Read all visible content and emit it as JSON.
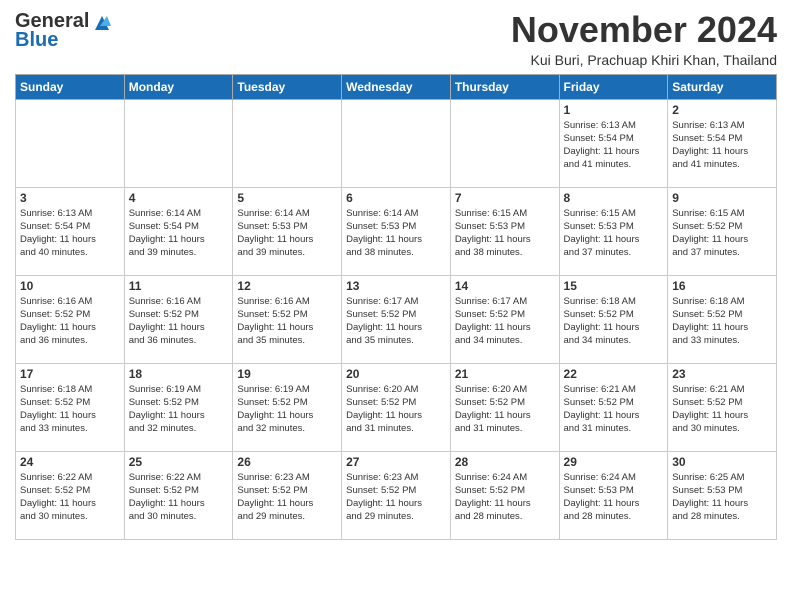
{
  "logo": {
    "general": "General",
    "blue": "Blue"
  },
  "header": {
    "month": "November 2024",
    "location": "Kui Buri, Prachuap Khiri Khan, Thailand"
  },
  "weekdays": [
    "Sunday",
    "Monday",
    "Tuesday",
    "Wednesday",
    "Thursday",
    "Friday",
    "Saturday"
  ],
  "weeks": [
    [
      {
        "day": "",
        "info": ""
      },
      {
        "day": "",
        "info": ""
      },
      {
        "day": "",
        "info": ""
      },
      {
        "day": "",
        "info": ""
      },
      {
        "day": "",
        "info": ""
      },
      {
        "day": "1",
        "info": "Sunrise: 6:13 AM\nSunset: 5:54 PM\nDaylight: 11 hours\nand 41 minutes."
      },
      {
        "day": "2",
        "info": "Sunrise: 6:13 AM\nSunset: 5:54 PM\nDaylight: 11 hours\nand 41 minutes."
      }
    ],
    [
      {
        "day": "3",
        "info": "Sunrise: 6:13 AM\nSunset: 5:54 PM\nDaylight: 11 hours\nand 40 minutes."
      },
      {
        "day": "4",
        "info": "Sunrise: 6:14 AM\nSunset: 5:54 PM\nDaylight: 11 hours\nand 39 minutes."
      },
      {
        "day": "5",
        "info": "Sunrise: 6:14 AM\nSunset: 5:53 PM\nDaylight: 11 hours\nand 39 minutes."
      },
      {
        "day": "6",
        "info": "Sunrise: 6:14 AM\nSunset: 5:53 PM\nDaylight: 11 hours\nand 38 minutes."
      },
      {
        "day": "7",
        "info": "Sunrise: 6:15 AM\nSunset: 5:53 PM\nDaylight: 11 hours\nand 38 minutes."
      },
      {
        "day": "8",
        "info": "Sunrise: 6:15 AM\nSunset: 5:53 PM\nDaylight: 11 hours\nand 37 minutes."
      },
      {
        "day": "9",
        "info": "Sunrise: 6:15 AM\nSunset: 5:52 PM\nDaylight: 11 hours\nand 37 minutes."
      }
    ],
    [
      {
        "day": "10",
        "info": "Sunrise: 6:16 AM\nSunset: 5:52 PM\nDaylight: 11 hours\nand 36 minutes."
      },
      {
        "day": "11",
        "info": "Sunrise: 6:16 AM\nSunset: 5:52 PM\nDaylight: 11 hours\nand 36 minutes."
      },
      {
        "day": "12",
        "info": "Sunrise: 6:16 AM\nSunset: 5:52 PM\nDaylight: 11 hours\nand 35 minutes."
      },
      {
        "day": "13",
        "info": "Sunrise: 6:17 AM\nSunset: 5:52 PM\nDaylight: 11 hours\nand 35 minutes."
      },
      {
        "day": "14",
        "info": "Sunrise: 6:17 AM\nSunset: 5:52 PM\nDaylight: 11 hours\nand 34 minutes."
      },
      {
        "day": "15",
        "info": "Sunrise: 6:18 AM\nSunset: 5:52 PM\nDaylight: 11 hours\nand 34 minutes."
      },
      {
        "day": "16",
        "info": "Sunrise: 6:18 AM\nSunset: 5:52 PM\nDaylight: 11 hours\nand 33 minutes."
      }
    ],
    [
      {
        "day": "17",
        "info": "Sunrise: 6:18 AM\nSunset: 5:52 PM\nDaylight: 11 hours\nand 33 minutes."
      },
      {
        "day": "18",
        "info": "Sunrise: 6:19 AM\nSunset: 5:52 PM\nDaylight: 11 hours\nand 32 minutes."
      },
      {
        "day": "19",
        "info": "Sunrise: 6:19 AM\nSunset: 5:52 PM\nDaylight: 11 hours\nand 32 minutes."
      },
      {
        "day": "20",
        "info": "Sunrise: 6:20 AM\nSunset: 5:52 PM\nDaylight: 11 hours\nand 31 minutes."
      },
      {
        "day": "21",
        "info": "Sunrise: 6:20 AM\nSunset: 5:52 PM\nDaylight: 11 hours\nand 31 minutes."
      },
      {
        "day": "22",
        "info": "Sunrise: 6:21 AM\nSunset: 5:52 PM\nDaylight: 11 hours\nand 31 minutes."
      },
      {
        "day": "23",
        "info": "Sunrise: 6:21 AM\nSunset: 5:52 PM\nDaylight: 11 hours\nand 30 minutes."
      }
    ],
    [
      {
        "day": "24",
        "info": "Sunrise: 6:22 AM\nSunset: 5:52 PM\nDaylight: 11 hours\nand 30 minutes."
      },
      {
        "day": "25",
        "info": "Sunrise: 6:22 AM\nSunset: 5:52 PM\nDaylight: 11 hours\nand 30 minutes."
      },
      {
        "day": "26",
        "info": "Sunrise: 6:23 AM\nSunset: 5:52 PM\nDaylight: 11 hours\nand 29 minutes."
      },
      {
        "day": "27",
        "info": "Sunrise: 6:23 AM\nSunset: 5:52 PM\nDaylight: 11 hours\nand 29 minutes."
      },
      {
        "day": "28",
        "info": "Sunrise: 6:24 AM\nSunset: 5:52 PM\nDaylight: 11 hours\nand 28 minutes."
      },
      {
        "day": "29",
        "info": "Sunrise: 6:24 AM\nSunset: 5:53 PM\nDaylight: 11 hours\nand 28 minutes."
      },
      {
        "day": "30",
        "info": "Sunrise: 6:25 AM\nSunset: 5:53 PM\nDaylight: 11 hours\nand 28 minutes."
      }
    ]
  ]
}
